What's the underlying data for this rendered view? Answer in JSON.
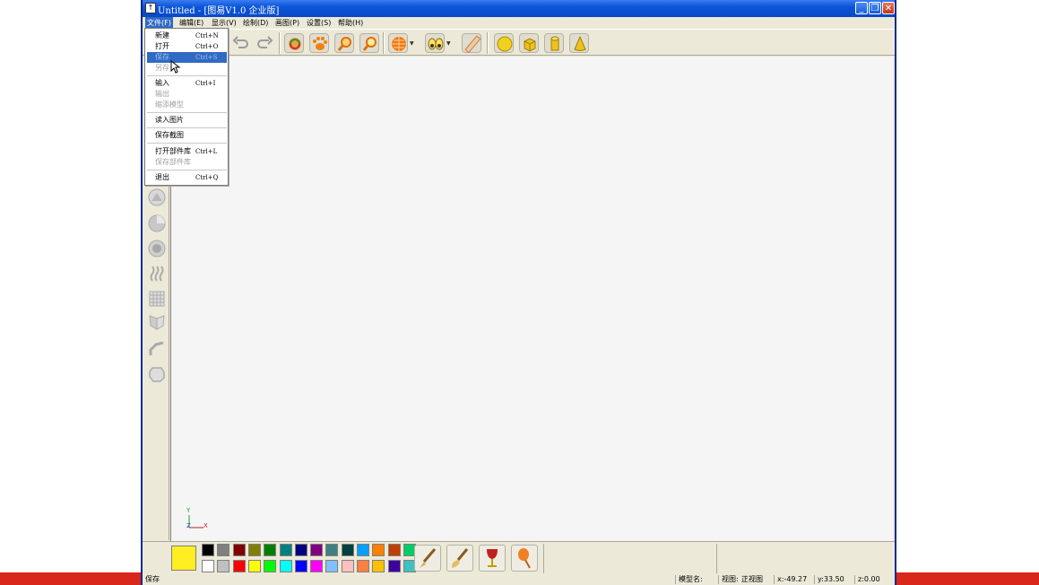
{
  "window": {
    "title": "Untitled - [图易V1.0 企业版]",
    "app_icon": "app-icon",
    "buttons": [
      "minimize-icon",
      "restore-icon",
      "close-icon"
    ]
  },
  "menubar": {
    "items": [
      "文件(F)",
      "编辑(E)",
      "显示(V)",
      "绘制(D)",
      "画图(P)",
      "设置(S)",
      "帮助(H)"
    ],
    "active_index": 0
  },
  "file_menu": {
    "items": [
      {
        "label": "新建",
        "shortcut": "Ctrl+N",
        "disabled": false
      },
      {
        "label": "打开",
        "shortcut": "Ctrl+O",
        "disabled": false
      },
      {
        "label": "保存",
        "shortcut": "Ctrl+S",
        "disabled": true,
        "highlighted": true
      },
      {
        "label": "另存",
        "shortcut": "",
        "disabled": true
      },
      {
        "label": "输入",
        "shortcut": "Ctrl+I",
        "disabled": false
      },
      {
        "label": "输出",
        "shortcut": "",
        "disabled": true
      },
      {
        "label": "缩添模型",
        "shortcut": "",
        "disabled": true
      },
      {
        "label": "读入图片",
        "shortcut": "",
        "disabled": false
      },
      {
        "label": "保存截图",
        "shortcut": "",
        "disabled": false
      },
      {
        "label": "打开部件库",
        "shortcut": "Ctrl+L",
        "disabled": false
      },
      {
        "label": "保存部件库",
        "shortcut": "",
        "disabled": true
      },
      {
        "label": "退出",
        "shortcut": "Ctrl+Q",
        "disabled": false
      }
    ]
  },
  "toolbar": {
    "icons": [
      "undo-icon",
      "redo-icon",
      "rotate-icon",
      "pan-icon",
      "zoom-in-icon",
      "zoom-out-icon",
      "render-sphere-icon",
      "view-eyes-icon",
      "ruler-icon",
      "sphere-icon",
      "cube-icon",
      "cylinder-icon",
      "cone-icon"
    ]
  },
  "left_toolbar": {
    "icons": [
      "extrude-icon",
      "revolve-icon",
      "shell-icon",
      "wave-icon",
      "grid-icon",
      "mirror-icon",
      "bend-icon",
      "deform-icon"
    ]
  },
  "axis": {
    "y": "Y",
    "z": "Z",
    "x": "X"
  },
  "palette": {
    "current_color": "#ffee22",
    "row1": [
      "#000000",
      "#808080",
      "#800000",
      "#808000",
      "#008000",
      "#008080",
      "#000080",
      "#800080",
      "#408080",
      "#004040",
      "#00a0ff",
      "#ff8000",
      "#c04000",
      "#00cc66"
    ],
    "row2": [
      "#ffffff",
      "#c0c0c0",
      "#ff0000",
      "#ffff00",
      "#00ff00",
      "#00ffff",
      "#0000ff",
      "#ff00ff",
      "#80c0ff",
      "#ffc0c0",
      "#ff8040",
      "#ffc000",
      "#4000a0",
      "#40c0c0"
    ]
  },
  "bottom_tools": [
    "brush-icon",
    "paint-brush-icon",
    "goblet-icon",
    "spray-icon"
  ],
  "statusbar": {
    "message": "保存",
    "model_name": "模型名:",
    "view_label": "视图:",
    "view_value": "正视图",
    "x": "x:-49.27",
    "y": "y:33.50",
    "z": "z:0.00"
  }
}
